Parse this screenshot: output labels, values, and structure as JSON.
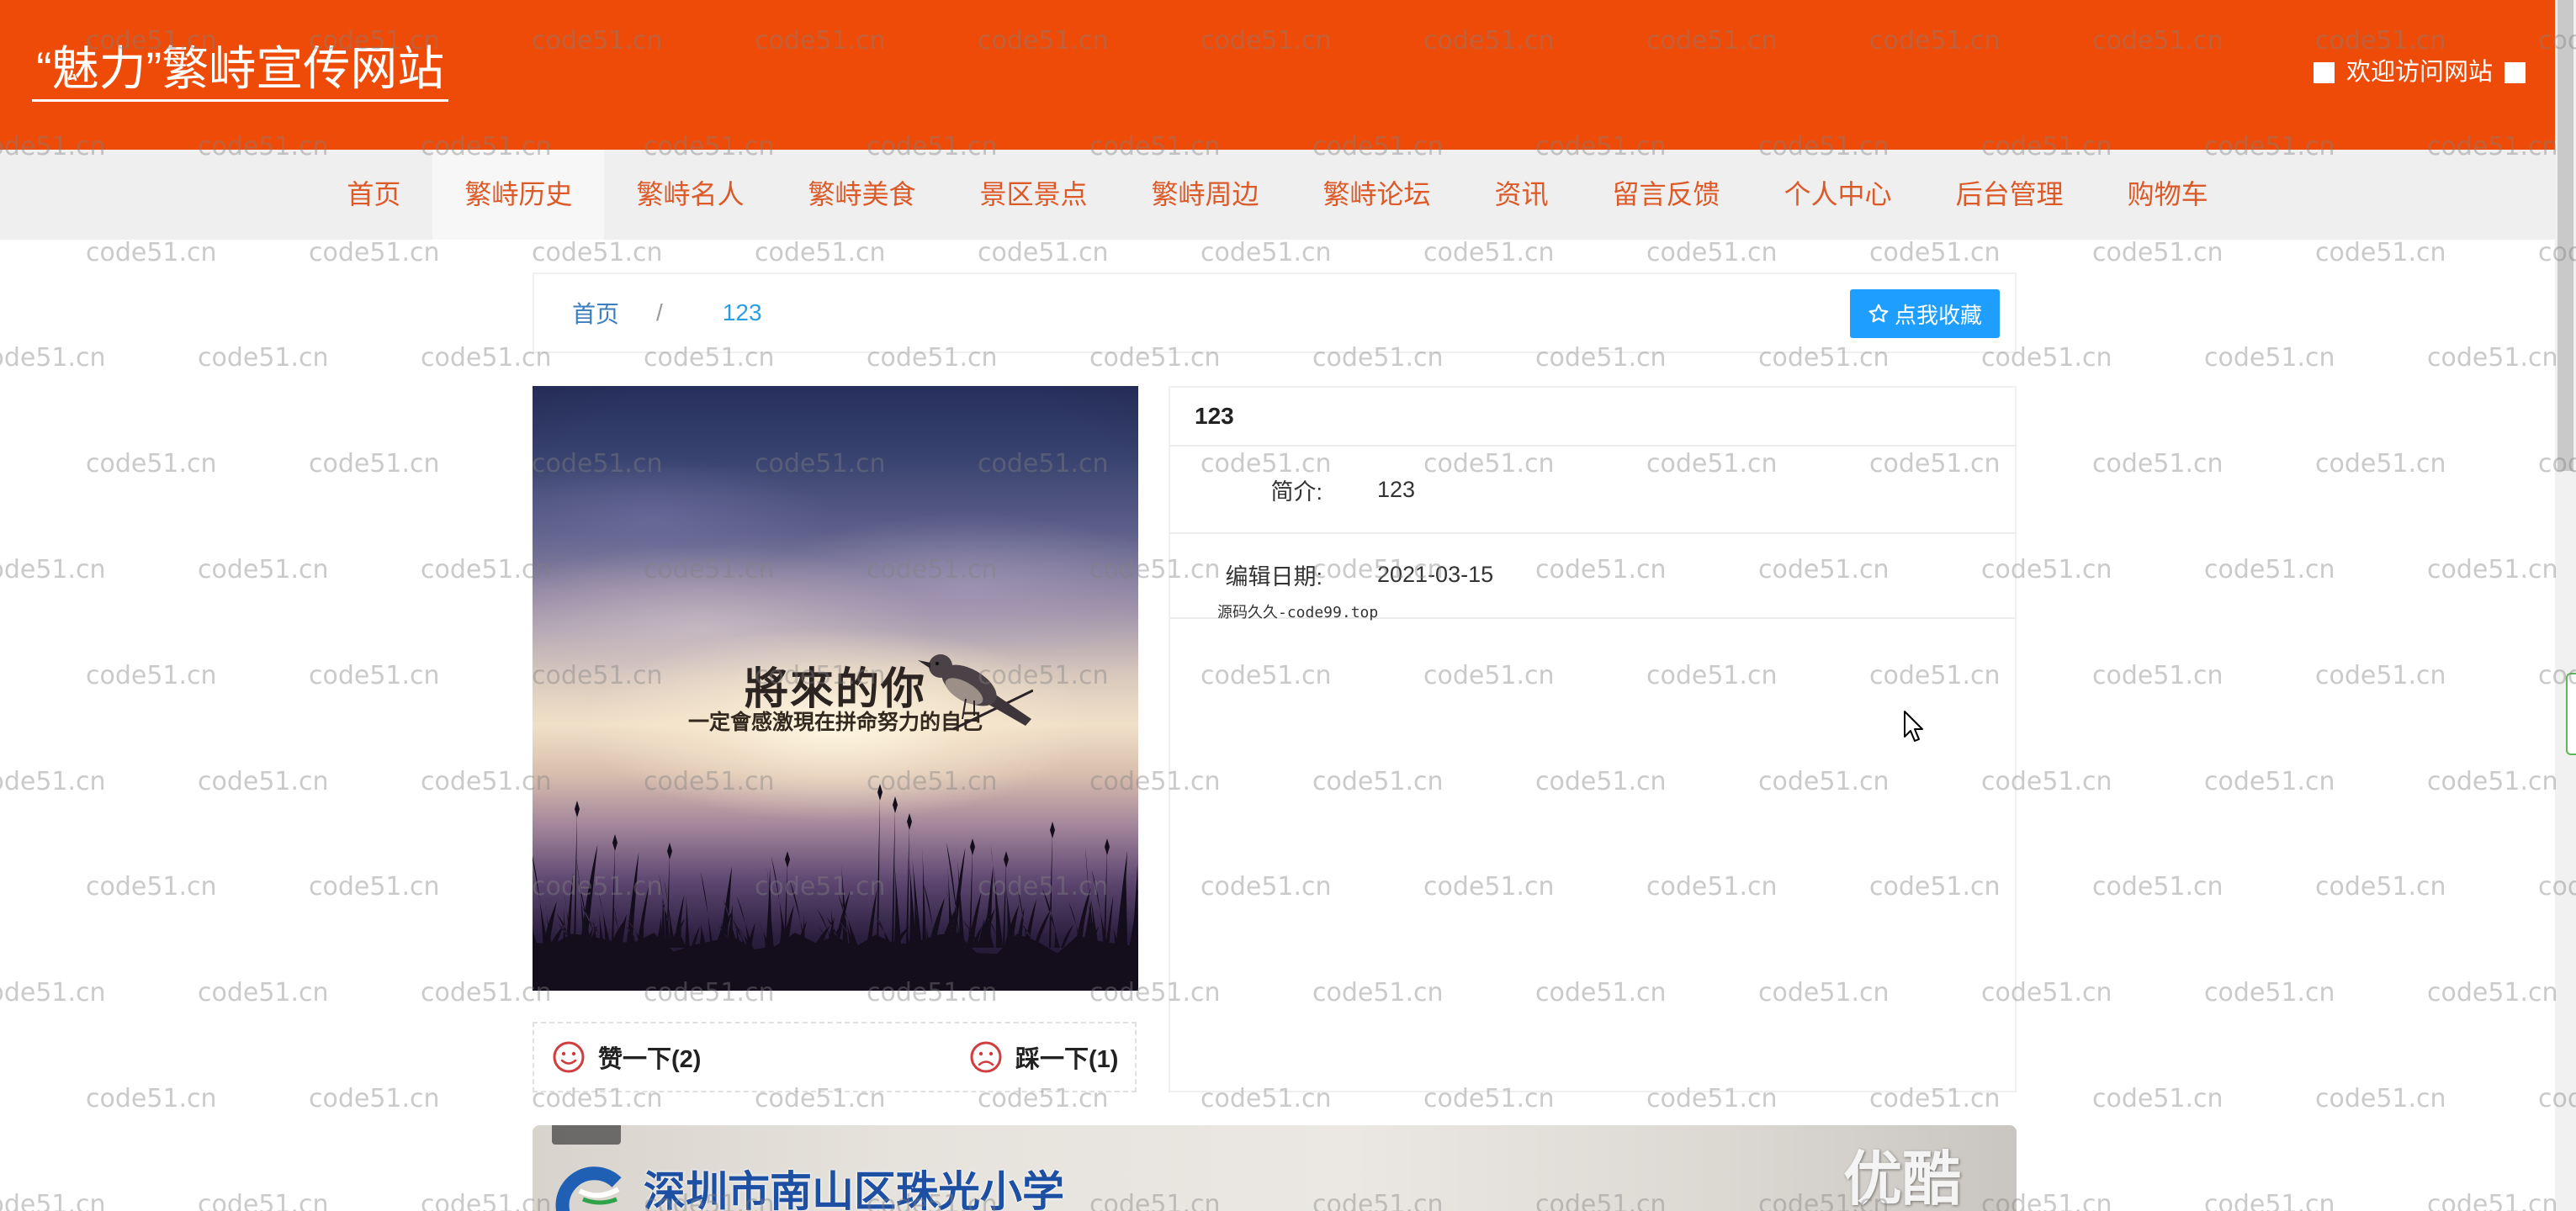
{
  "watermark": {
    "text": "code51.cn"
  },
  "header": {
    "site_title": "“魅力”繁峙宣传网站",
    "welcome_text": "欢迎访问网站"
  },
  "nav": {
    "active_index": 1,
    "items": [
      {
        "label": "首页"
      },
      {
        "label": "繁峙历史"
      },
      {
        "label": "繁峙名人"
      },
      {
        "label": "繁峙美食"
      },
      {
        "label": "景区景点"
      },
      {
        "label": "繁峙周边"
      },
      {
        "label": "繁峙论坛"
      },
      {
        "label": "资讯"
      },
      {
        "label": "留言反馈"
      },
      {
        "label": "个人中心"
      },
      {
        "label": "后台管理"
      },
      {
        "label": "购物车"
      }
    ]
  },
  "breadcrumb": {
    "home": "首页",
    "separator": "/",
    "current": "123"
  },
  "favorite_button": {
    "label": "点我收藏",
    "icon": "star-outline-icon"
  },
  "detail": {
    "image": {
      "caption_title": "將來的你",
      "caption_subtitle": "一定會感激現在拼命努力的自己"
    },
    "like": {
      "label": "赞一下(2)",
      "icon": "smile-icon"
    },
    "dislike": {
      "label": "踩一下(1)",
      "icon": "frown-icon"
    },
    "title": "123",
    "fields": [
      {
        "label": "简介:",
        "value": "123"
      },
      {
        "label": "编辑日期:",
        "value": "2021-03-15"
      }
    ],
    "source_note": "源码久久-code99.top"
  },
  "video": {
    "school_name": "深圳市南山区珠光小学",
    "platform_logo": "优酷"
  },
  "colors": {
    "header_bg": "#EE4A08",
    "nav_text": "#DC5A28",
    "primary_button": "#1E9FFF",
    "link": "#3C7EBF"
  }
}
